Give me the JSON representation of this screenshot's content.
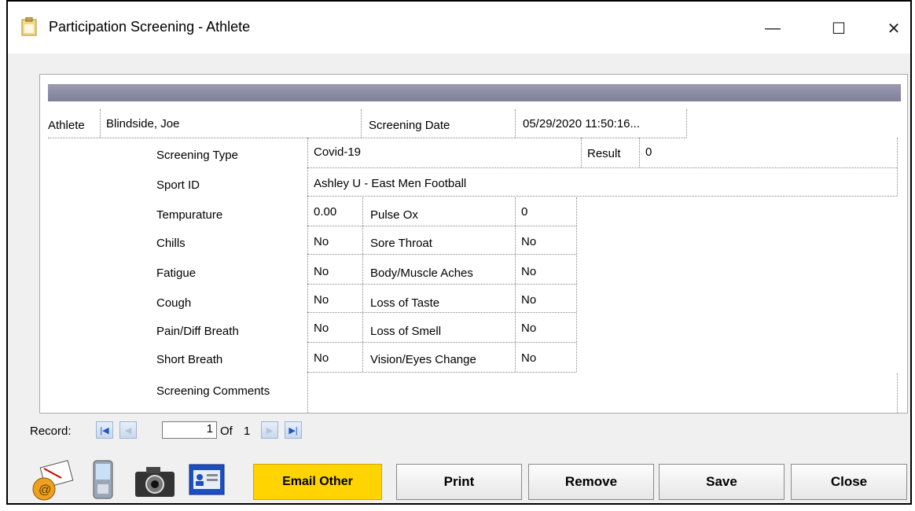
{
  "window": {
    "title": "Participation Screening - Athlete",
    "minimize_glyph": "—",
    "maximize_glyph": "☐",
    "close_glyph": "✕"
  },
  "athlete": {
    "label": "Athlete",
    "value": "Blindside, Joe"
  },
  "screening_date": {
    "label": "Screening Date",
    "value": "05/29/2020 11:50:16..."
  },
  "screening_type": {
    "label": "Screening Type",
    "value": "Covid-19"
  },
  "result": {
    "label": "Result",
    "value": "0"
  },
  "sport_id": {
    "label": "Sport ID",
    "value": "Ashley U - East Men Football"
  },
  "temperature": {
    "label": "Tempurature",
    "value": "0.00"
  },
  "pulse_ox": {
    "label": "Pulse Ox",
    "value": "0"
  },
  "symptoms_left": [
    {
      "label": "Chills",
      "value": "No"
    },
    {
      "label": "Fatigue",
      "value": "No"
    },
    {
      "label": "Cough",
      "value": "No"
    },
    {
      "label": "Pain/Diff Breath",
      "value": "No"
    },
    {
      "label": "Short Breath",
      "value": "No"
    }
  ],
  "symptoms_right": [
    {
      "label": "Sore Throat",
      "value": "No"
    },
    {
      "label": "Body/Muscle Aches",
      "value": "No"
    },
    {
      "label": "Loss of Taste",
      "value": "No"
    },
    {
      "label": "Loss of Smell",
      "value": "No"
    },
    {
      "label": "Vision/Eyes Change",
      "value": "No"
    }
  ],
  "comments": {
    "label": "Screening Comments",
    "value": ""
  },
  "record_nav": {
    "label": "Record:",
    "current": "1",
    "of_label": "Of",
    "total": "1"
  },
  "buttons": {
    "email_other": "Email Other",
    "print": "Print",
    "remove": "Remove",
    "save": "Save",
    "close": "Close"
  },
  "toolbar_icons": [
    "email-icon",
    "mobile-device-icon",
    "camera-icon",
    "id-card-icon"
  ],
  "colors": {
    "header_bar": "#8a8aa3",
    "email_button": "#ffd400",
    "nav_accent": "#1a56c8"
  }
}
